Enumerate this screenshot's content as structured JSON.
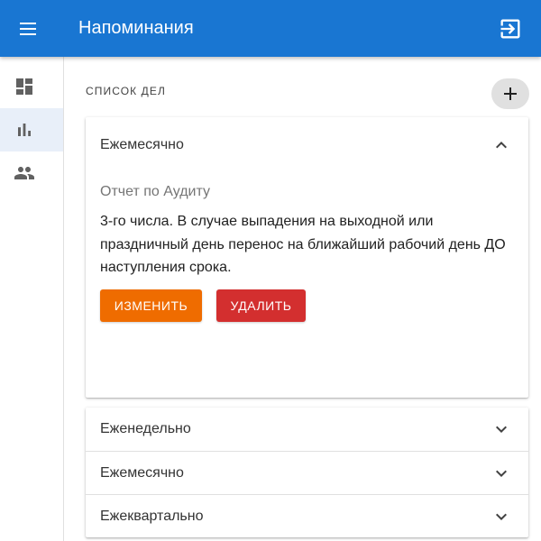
{
  "header": {
    "title": "Напоминания",
    "menu_icon": "menu-icon",
    "logout_icon": "logout-icon",
    "background": "#1976d2"
  },
  "sidebar": {
    "items": [
      {
        "icon": "dashboard-icon",
        "active": false
      },
      {
        "icon": "bar-chart-icon",
        "active": true
      },
      {
        "icon": "people-icon",
        "active": false
      }
    ]
  },
  "main": {
    "section_title": "СПИСОК ДЕЛ",
    "add_icon": "plus-icon",
    "expanded_panel": {
      "header": "Ежемесячно",
      "subtitle": "Отчет по Аудиту",
      "description": "3-го числа. В случае выпадения на выходной или праздничный день перенос на ближайший рабочий день ДО наступления срока.",
      "edit_label": "ИЗМЕНИТЬ",
      "delete_label": "УДАЛИТЬ",
      "edit_color": "#ef6c00",
      "delete_color": "#d32f2f"
    },
    "collapsed_panels": [
      {
        "label": "Еженедельно"
      },
      {
        "label": "Ежемесячно"
      },
      {
        "label": "Ежеквартально"
      }
    ]
  }
}
